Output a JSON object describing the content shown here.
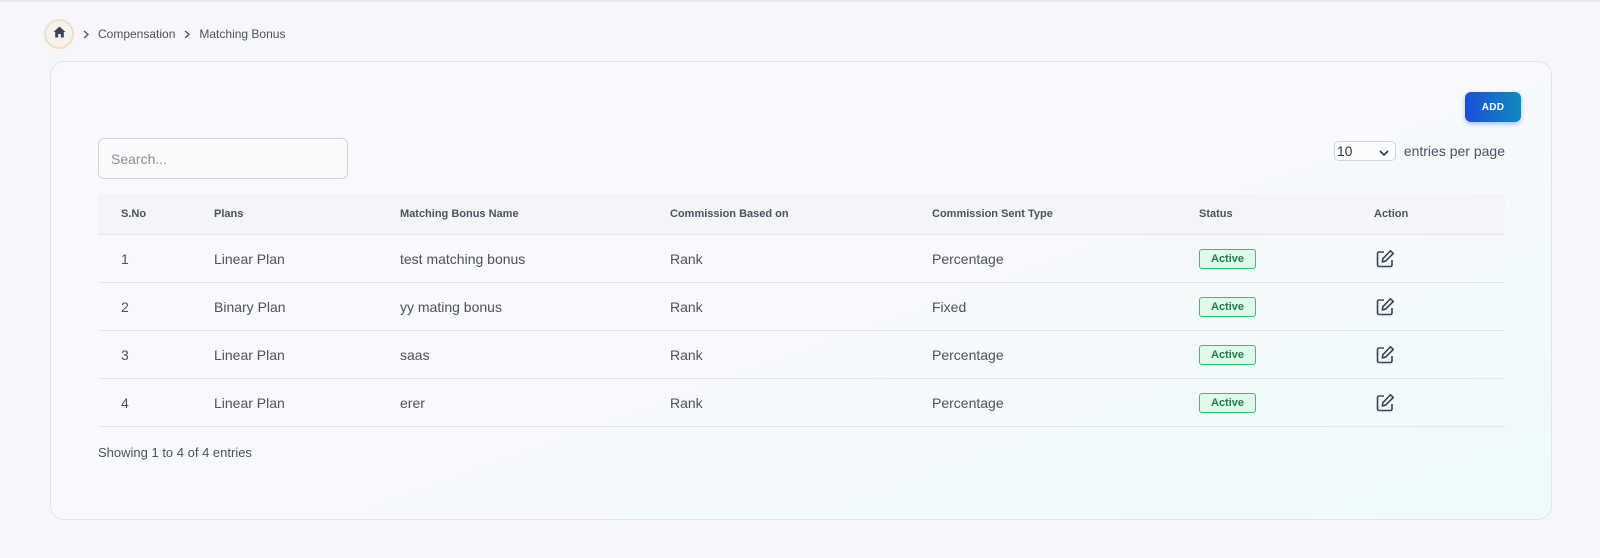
{
  "breadcrumb": {
    "home_icon": "home-icon",
    "items": [
      "Compensation",
      "Matching Bonus"
    ]
  },
  "toolbar": {
    "add_label": "ADD",
    "search_placeholder": "Search...",
    "entries_value": "10",
    "entries_label": "entries per page"
  },
  "table": {
    "headers": [
      "S.No",
      "Plans",
      "Matching Bonus Name",
      "Commission Based on",
      "Commission Sent Type",
      "Status",
      "Action"
    ],
    "rows": [
      {
        "sno": "1",
        "plan": "Linear Plan",
        "name": "test matching bonus",
        "based_on": "Rank",
        "sent_type": "Percentage",
        "status": "Active"
      },
      {
        "sno": "2",
        "plan": "Binary Plan",
        "name": "yy mating bonus",
        "based_on": "Rank",
        "sent_type": "Fixed",
        "status": "Active"
      },
      {
        "sno": "3",
        "plan": "Linear Plan",
        "name": "saas",
        "based_on": "Rank",
        "sent_type": "Percentage",
        "status": "Active"
      },
      {
        "sno": "4",
        "plan": "Linear Plan",
        "name": "erer",
        "based_on": "Rank",
        "sent_type": "Percentage",
        "status": "Active"
      }
    ]
  },
  "footer": {
    "info": "Showing 1 to 4 of 4 entries"
  },
  "colors": {
    "accent_start": "#1a4fd8",
    "accent_end": "#0e8bbd",
    "status_active": "#35c268"
  }
}
